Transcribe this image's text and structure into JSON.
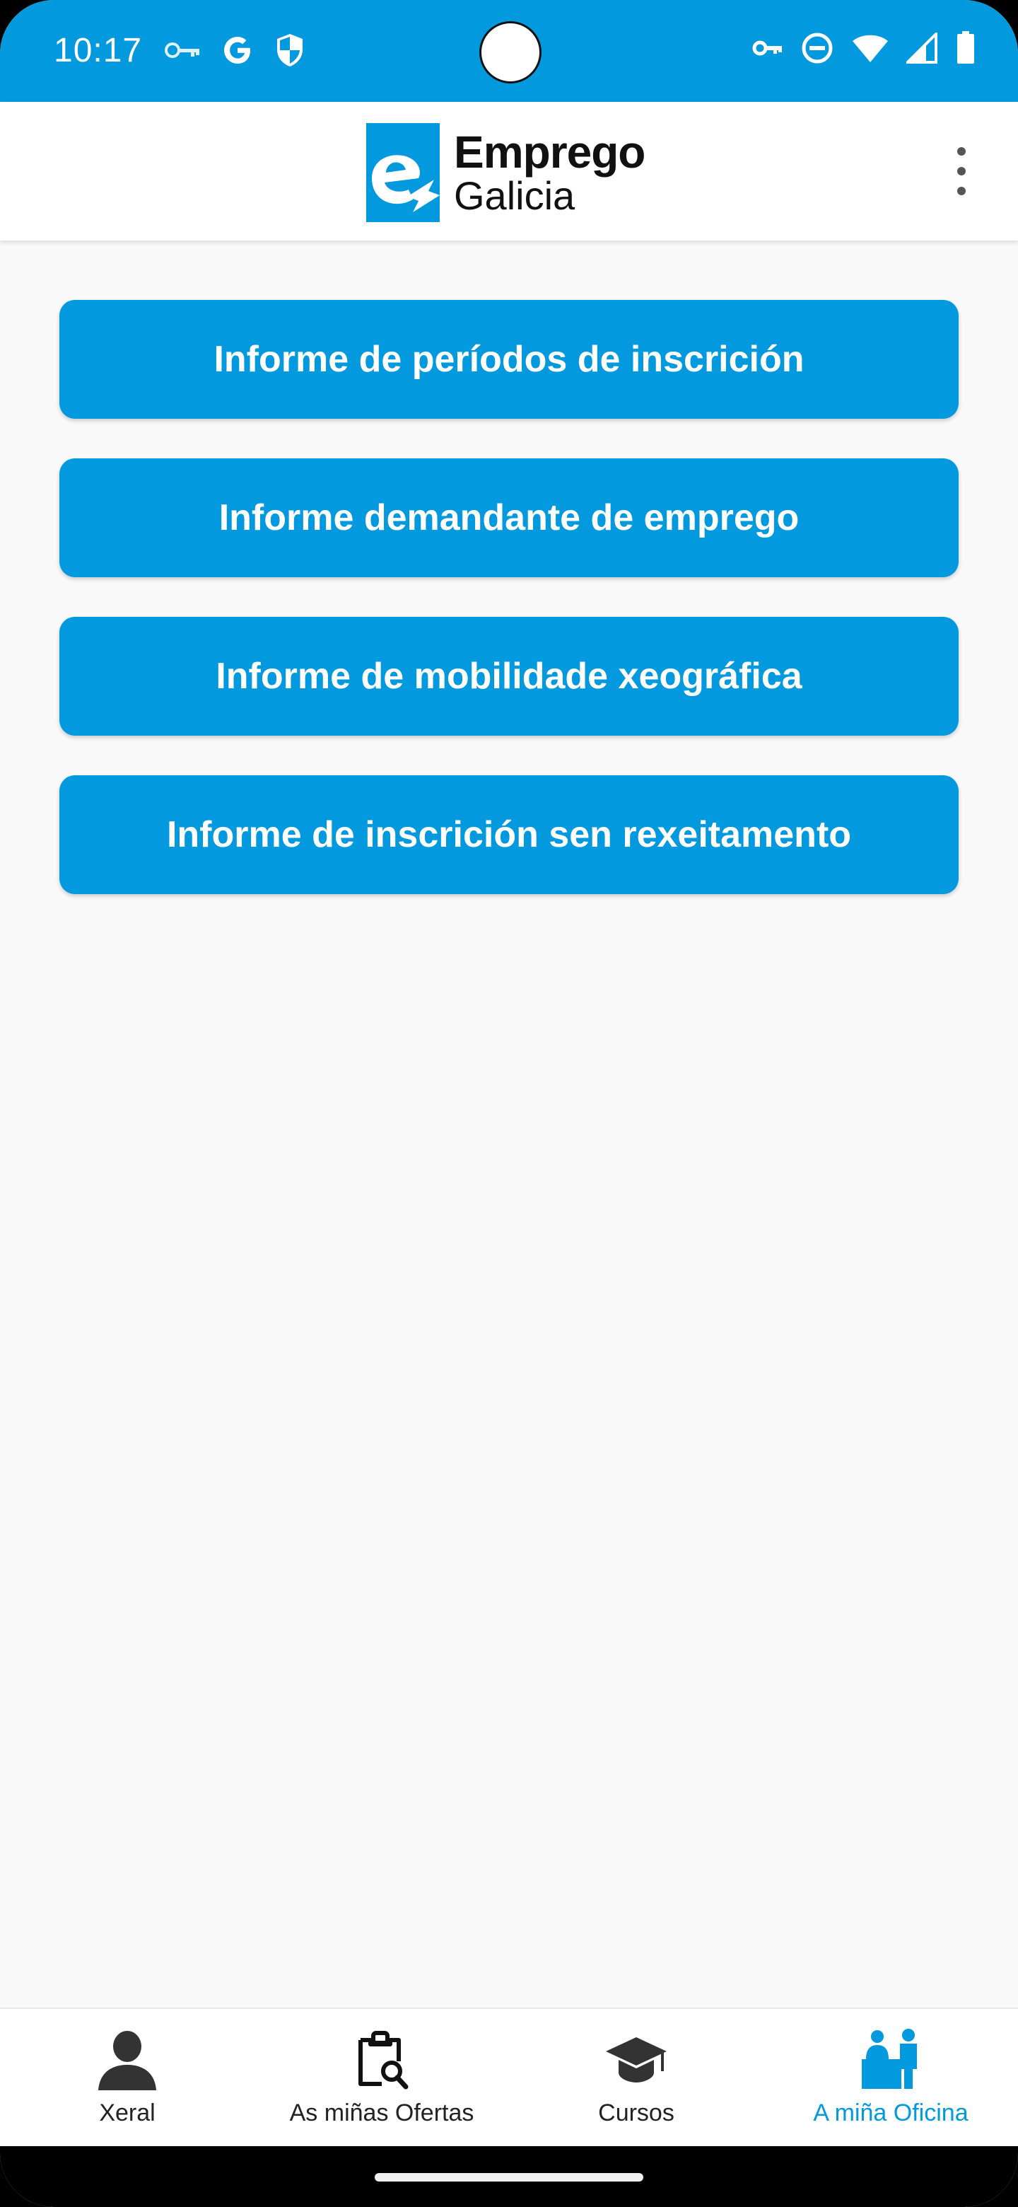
{
  "status_bar": {
    "time": "10:17",
    "left_icons": [
      "vpn-key-icon",
      "google-icon",
      "shield-icon"
    ],
    "right_icons": [
      "vpn-key-icon",
      "do-not-disturb-icon",
      "wifi-icon",
      "signal-icon",
      "battery-icon"
    ]
  },
  "app_bar": {
    "logo_line1": "Emprego",
    "logo_line2": "Galicia",
    "menu_icon": "more-vert-icon"
  },
  "reports": [
    {
      "label": "Informe de períodos de inscrición"
    },
    {
      "label": "Informe demandante de emprego"
    },
    {
      "label": "Informe de mobilidade xeográfica"
    },
    {
      "label": "Informe de inscrición sen rexeitamento"
    }
  ],
  "bottom_nav": {
    "items": [
      {
        "label": "Xeral",
        "icon": "person-icon"
      },
      {
        "label": "As miñas Ofertas",
        "icon": "clipboard-search-icon"
      },
      {
        "label": "Cursos",
        "icon": "graduation-cap-icon"
      },
      {
        "label": "A miña Oficina",
        "icon": "office-people-icon"
      }
    ],
    "active_index": 3
  },
  "colors": {
    "brand": "#0299de",
    "background": "#f9f9f9",
    "nav_text": "#222222"
  }
}
